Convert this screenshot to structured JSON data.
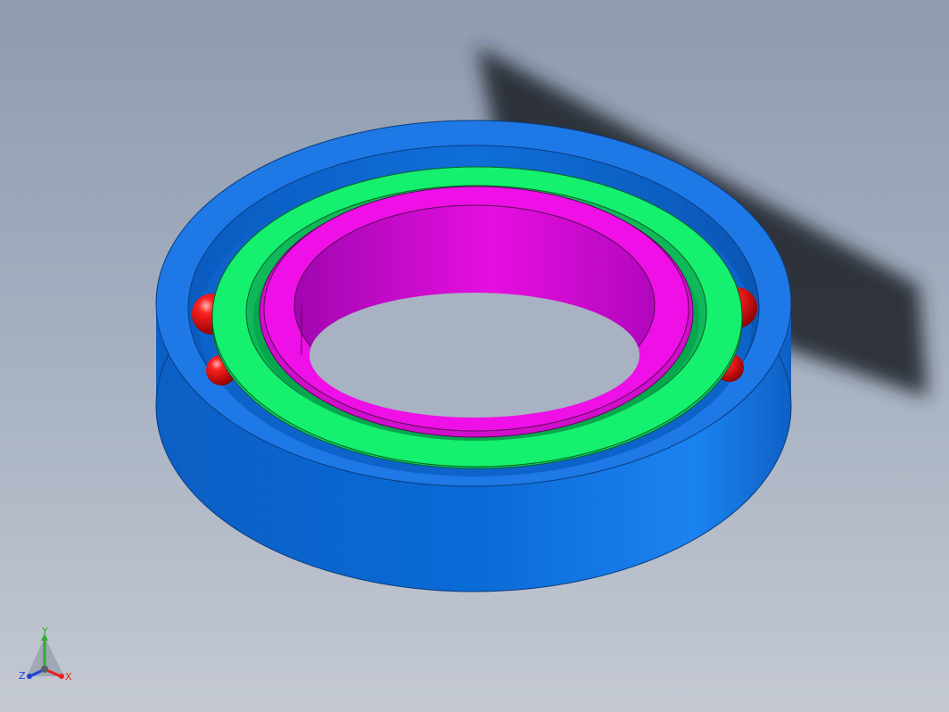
{
  "viewport": {
    "background_top": "#8e9bb0",
    "background_bottom": "#c4c9d2"
  },
  "model": {
    "parts": [
      {
        "name": "outer-ring",
        "color": "#1e78e6"
      },
      {
        "name": "inner-ring-green",
        "color": "#15f06e"
      },
      {
        "name": "inner-ring-magenta",
        "color": "#ee10e6"
      },
      {
        "name": "balls",
        "color": "#f01a1a"
      }
    ],
    "shadow_color": "#2b2f38"
  },
  "triad": {
    "x_label": "X",
    "y_label": "Y",
    "z_label": "Z",
    "x_color": "#e8201c",
    "y_color": "#2fae2f",
    "z_color": "#2140d8"
  }
}
